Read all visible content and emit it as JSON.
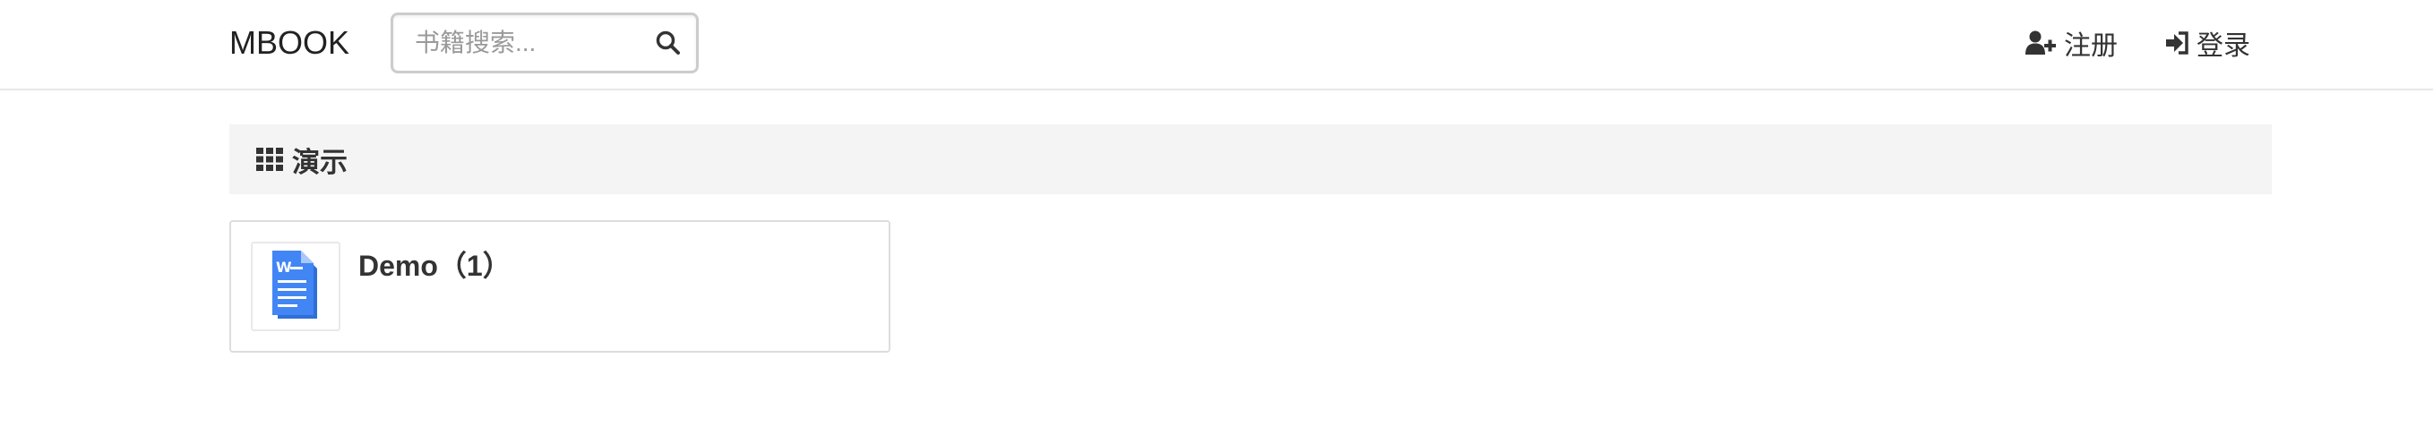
{
  "header": {
    "brand": "MBOOK",
    "search": {
      "placeholder": "书籍搜索...",
      "value": "",
      "icon": "search-icon"
    },
    "register": {
      "label": "注册",
      "icon": "user-plus-icon"
    },
    "login": {
      "label": "登录",
      "icon": "sign-in-icon"
    }
  },
  "category": {
    "icon": "grid-icon",
    "title": "演示"
  },
  "books": [
    {
      "title": "Demo（1）",
      "icon": "word-document-icon",
      "accent": "#4285f4"
    }
  ],
  "colors": {
    "text": "#333333",
    "category_bg": "#f4f4f4",
    "document_blue": "#4285f4"
  }
}
